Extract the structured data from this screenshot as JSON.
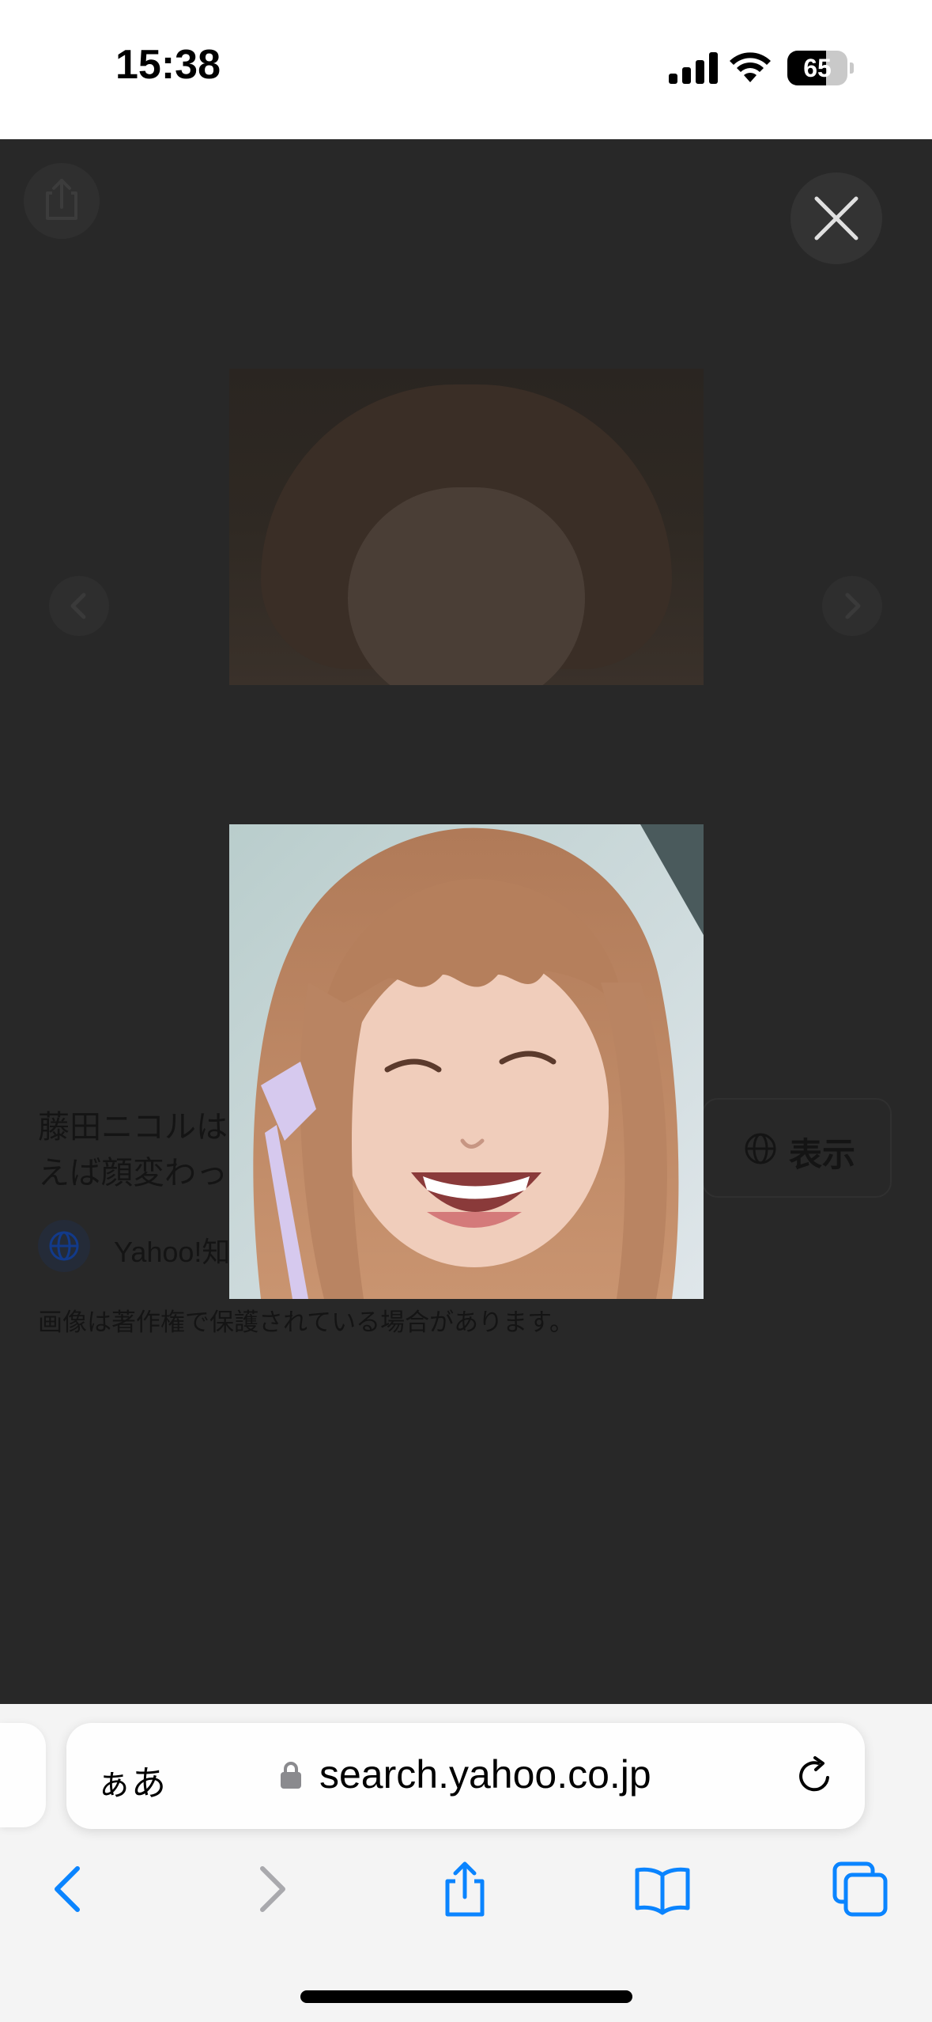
{
  "status_bar": {
    "time": "15:38",
    "battery_level": "65",
    "battery_fraction": 0.65
  },
  "viewer": {
    "caption_line1": "藤田ニコルは",
    "caption_line2": "えば顔変わったな垢抜けたなー ...",
    "view_button_label": "表示",
    "source": "Yahoo!知恵袋 - Yahoo! JAPAN - 200×200",
    "copyright_notice": "画像は著作権で保護されている場合があります。",
    "icons": {
      "share": "share-icon",
      "close": "close-icon",
      "prev": "chevron-left-icon",
      "next": "chevron-right-icon",
      "globe": "globe-icon"
    }
  },
  "browser": {
    "text_size_label": "ぁあ",
    "url": "search.yahoo.co.jp",
    "accent": "#0a84ff",
    "toolbar_icons": [
      "back-icon",
      "forward-icon",
      "share-icon",
      "bookmarks-icon",
      "tabs-icon"
    ]
  }
}
